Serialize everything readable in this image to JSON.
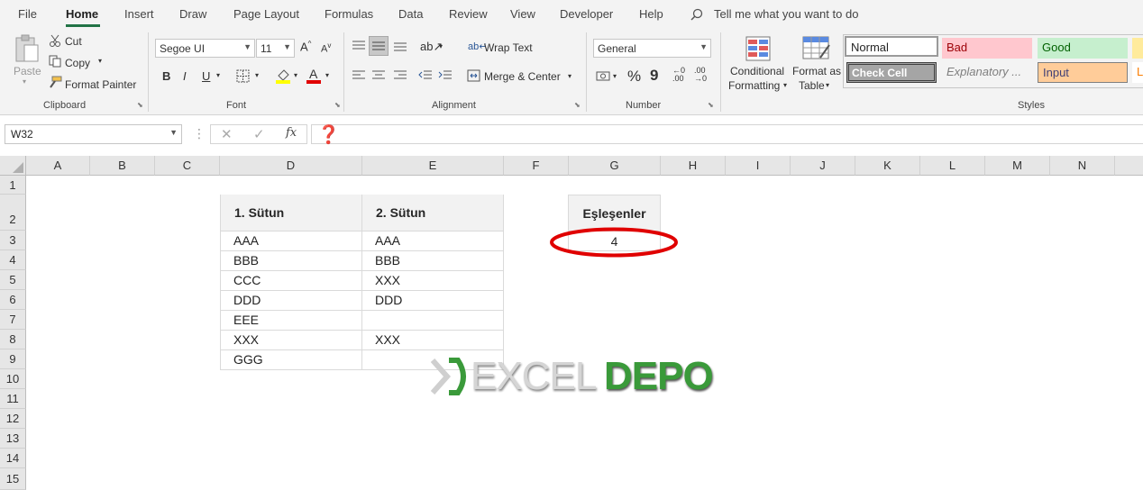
{
  "menu": {
    "tabs": [
      "File",
      "Home",
      "Insert",
      "Draw",
      "Page Layout",
      "Formulas",
      "Data",
      "Review",
      "View",
      "Developer",
      "Help"
    ],
    "tell_me": "Tell me what you want to do"
  },
  "clipboard": {
    "paste": "Paste",
    "cut": "Cut",
    "copy": "Copy",
    "format_painter": "Format Painter",
    "label": "Clipboard"
  },
  "font": {
    "name": "Segoe UI",
    "size": "11",
    "bold": "B",
    "italic": "I",
    "underline": "U",
    "label": "Font"
  },
  "alignment": {
    "wrap": "Wrap Text",
    "merge": "Merge & Center",
    "label": "Alignment"
  },
  "number": {
    "format": "General",
    "percent": "%",
    "comma": "9",
    "label": "Number"
  },
  "styles": {
    "conditional_1": "Conditional",
    "conditional_2": "Formatting",
    "format_as_1": "Format as",
    "format_as_2": "Table",
    "normal": "Normal",
    "bad": "Bad",
    "good": "Good",
    "check_cell": "Check Cell",
    "explanatory": "Explanatory ...",
    "input": "Input",
    "label": "Styles"
  },
  "formula_bar": {
    "name_box": "W32",
    "content": "❓"
  },
  "columns": [
    "A",
    "B",
    "C",
    "D",
    "E",
    "F",
    "G",
    "H",
    "I",
    "J",
    "K",
    "L",
    "M",
    "N"
  ],
  "rows": [
    "1",
    "2",
    "3",
    "4",
    "5",
    "6",
    "7",
    "8",
    "9",
    "10",
    "11",
    "12",
    "13",
    "14",
    "15"
  ],
  "sheet": {
    "headers": [
      "1. Sütun",
      "2. Sütun"
    ],
    "col1": [
      "AAA",
      "BBB",
      "CCC",
      "DDD",
      "EEE",
      "XXX",
      "GGG"
    ],
    "col2": [
      "AAA",
      "BBB",
      "XXX",
      "DDD",
      "",
      "XXX",
      ""
    ],
    "match_header": "Eşleşenler",
    "match_value": "4"
  },
  "watermark": {
    "part1": "EXCEL",
    "part2": "DEPO"
  },
  "colors": {
    "accent": "#217346",
    "circle": "#e00000",
    "depo": "#3a9a3a"
  }
}
